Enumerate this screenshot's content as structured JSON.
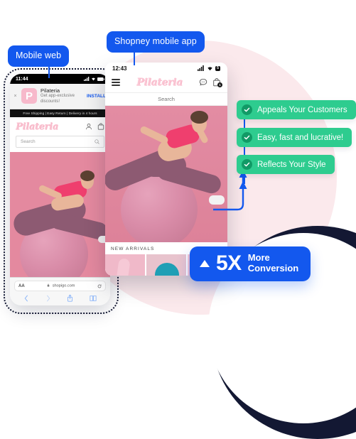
{
  "labels": {
    "mobile_web": "Mobile web",
    "shopney_app": "Shopney mobile app"
  },
  "mobile_web_phone": {
    "status": {
      "time": "11:44",
      "signal_icon": "signal-bars-icon",
      "wifi_icon": "wifi-icon",
      "battery_icon": "battery-icon"
    },
    "smart_banner": {
      "close_label": "×",
      "app_icon_letter": "P",
      "title": "Pilateria",
      "subtitle": "Get app-exclusive discounts!",
      "cta": "INSTALL"
    },
    "promo_bar": "Free Shipping | Easy Return | Delivery in 4 hours",
    "brand": "Pilateria",
    "header_icons": [
      "account-icon",
      "bag-icon"
    ],
    "search_placeholder": "Search",
    "search_icon": "search-icon",
    "browser": {
      "aa_label": "AA",
      "lock_icon": "lock-icon",
      "url": "shopigo.com",
      "reload_icon": "reload-icon",
      "back_icon": "chevron-left-icon",
      "forward_icon": "chevron-right-icon",
      "share_icon": "share-icon",
      "bookmarks_icon": "book-icon"
    }
  },
  "shopney_app_phone": {
    "status": {
      "time": "12:43",
      "signal_icon": "signal-bars-icon",
      "wifi_icon": "wifi-icon",
      "battery_level": "5"
    },
    "menu_icon": "hamburger-menu-icon",
    "brand": "Pilateria",
    "chat_icon": "chat-bubble-icon",
    "bag_icon": "shopping-bag-icon",
    "cart_badge": "1",
    "search_placeholder": "Search",
    "section_title": "NEW ARRIVALS"
  },
  "features": [
    {
      "label": "Appeals Your Customers",
      "icon": "check-circle-icon"
    },
    {
      "label": "Easy, fast and lucrative!",
      "icon": "check-circle-icon"
    },
    {
      "label": "Reflects Your Style",
      "icon": "check-circle-icon"
    }
  ],
  "conversion_badge": {
    "arrow_icon": "triangle-up-icon",
    "multiplier": "5X",
    "line1": "More",
    "line2": "Conversion"
  },
  "colors": {
    "brand_blue": "#1358ee",
    "feature_green": "#2ecc8f",
    "check_green": "#119a66",
    "pink_bg": "#fbe9ec",
    "navy": "#131833",
    "brand_pink": "#f9c0cf"
  }
}
